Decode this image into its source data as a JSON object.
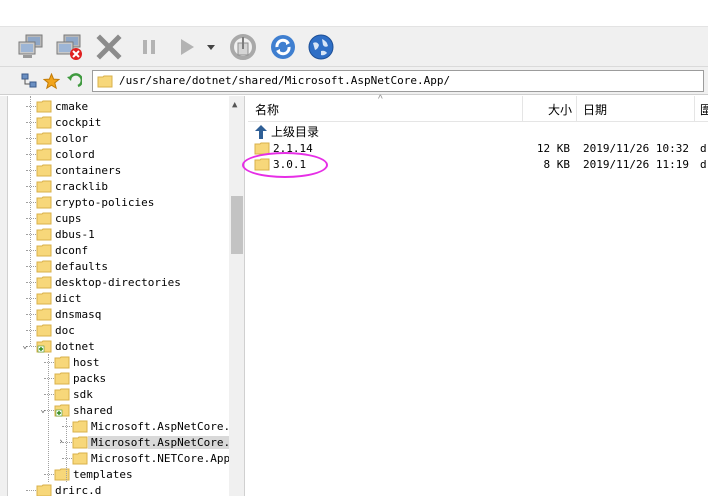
{
  "toolbar": {
    "buttons": [
      {
        "name": "connect",
        "icon": "computers-connect-icon"
      },
      {
        "name": "disconnect",
        "icon": "computers-disconnect-icon"
      },
      {
        "name": "stop",
        "icon": "close-x-icon"
      },
      {
        "name": "pause",
        "icon": "pause-icon"
      },
      {
        "name": "play",
        "icon": "play-icon"
      },
      {
        "name": "play-menu",
        "icon": "dropdown-arrow-icon"
      },
      {
        "name": "sync",
        "icon": "sync-icon"
      },
      {
        "name": "refresh",
        "icon": "refresh-icon"
      },
      {
        "name": "web",
        "icon": "globe-icon"
      }
    ]
  },
  "address": {
    "path": "/usr/share/dotnet/shared/Microsoft.AspNetCore.App/"
  },
  "tree": {
    "items": [
      {
        "label": "cmake"
      },
      {
        "label": "cockpit"
      },
      {
        "label": "color"
      },
      {
        "label": "colord"
      },
      {
        "label": "containers"
      },
      {
        "label": "cracklib"
      },
      {
        "label": "crypto-policies"
      },
      {
        "label": "cups"
      },
      {
        "label": "dbus-1"
      },
      {
        "label": "dconf"
      },
      {
        "label": "defaults"
      },
      {
        "label": "desktop-directories"
      },
      {
        "label": "dict"
      },
      {
        "label": "dnsmasq"
      },
      {
        "label": "doc"
      },
      {
        "label": "dotnet"
      },
      {
        "label": "host"
      },
      {
        "label": "packs"
      },
      {
        "label": "sdk"
      },
      {
        "label": "shared"
      },
      {
        "label": "Microsoft.AspNetCore.Al"
      },
      {
        "label": "Microsoft.AspNetCore.Ap"
      },
      {
        "label": "Microsoft.NETCore.App"
      },
      {
        "label": "templates"
      },
      {
        "label": "drirc.d"
      }
    ]
  },
  "filelist": {
    "headers": {
      "name": "名称",
      "size": "大小",
      "date": "日期",
      "type": "圍"
    },
    "parent_label": "上级目录",
    "rows": [
      {
        "name": "2.1.14",
        "size": "12 KB",
        "date": "2019/11/26 10:32",
        "type": "d"
      },
      {
        "name": "3.0.1",
        "size": "8 KB",
        "date": "2019/11/26 11:19",
        "type": "d"
      }
    ]
  },
  "colors": {
    "highlight": "#e62ee6",
    "folder": "#f7d77a"
  }
}
